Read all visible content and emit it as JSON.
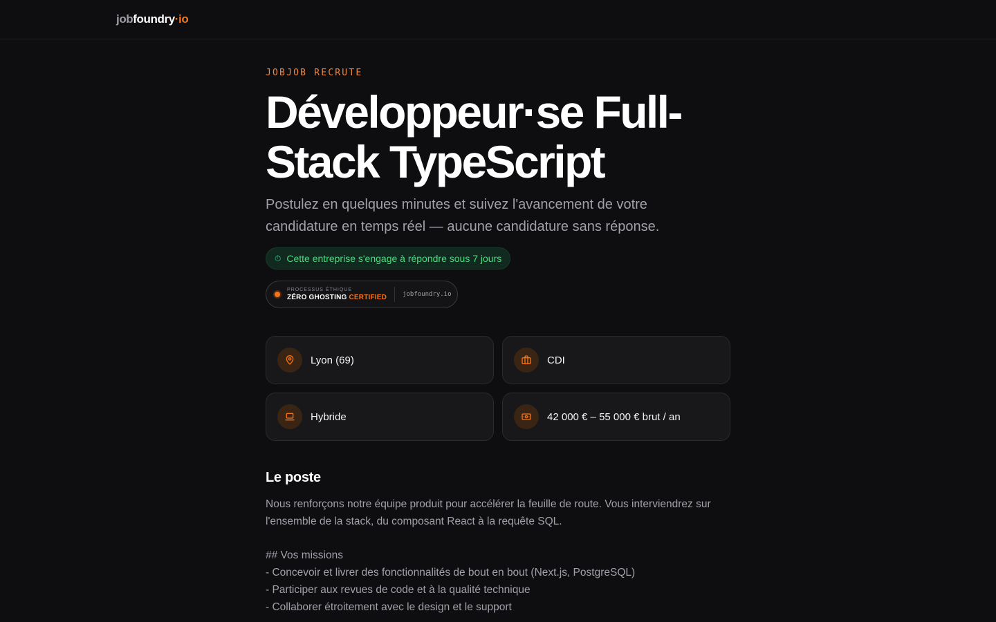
{
  "brand": {
    "part1": "job",
    "part2": "foundry",
    "part3": "·io"
  },
  "job": {
    "eyebrow": "JOBJOB RECRUTE",
    "title": "Développeur·se Full-Stack TypeScript",
    "subtitle": "Postulez en quelques minutes et suivez l'avancement de votre candidature en temps réel — aucune candidature sans réponse.",
    "commitment_badge": "Cette entreprise s'engage à répondre sous 7 jours",
    "certified": {
      "small": "PROCESSUS ÉTHIQUE",
      "big_white": "ZÉRO GHOSTING ",
      "big_orange": "CERTIFIED",
      "domain": "jobfoundry.io"
    },
    "details": [
      {
        "icon": "location-pin-icon",
        "value": "Lyon (69)"
      },
      {
        "icon": "briefcase-icon",
        "value": "CDI"
      },
      {
        "icon": "laptop-icon",
        "value": "Hybride"
      },
      {
        "icon": "banknote-icon",
        "value": "42 000 € – 55 000 € brut / an"
      }
    ],
    "section_title": "Le poste",
    "description_lines": [
      "Nous renforçons notre équipe produit pour accélérer la feuille de route. Vous interviendrez sur l'ensemble de la stack, du composant React à la requête SQL.",
      "",
      "## Vos missions",
      "- Concevoir et livrer des fonctionnalités de bout en bout (Next.js, PostgreSQL)",
      "- Participer aux revues de code et à la qualité technique",
      "- Collaborer étroitement avec le design et le support"
    ]
  },
  "colors": {
    "accent": "#f97316",
    "success": "#4ade80",
    "background": "#0e0e10"
  }
}
